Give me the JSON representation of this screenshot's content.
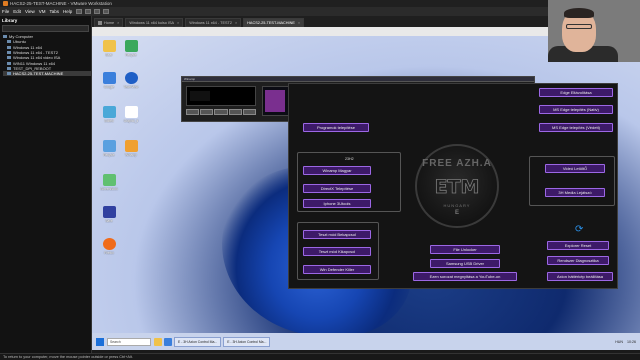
{
  "window": {
    "title": "HACS2-25-TEST-MACHINE - VMware Workstation"
  },
  "menu": [
    "File",
    "Edit",
    "View",
    "VM",
    "Tabs",
    "Help"
  ],
  "tabs": [
    {
      "label": "Home"
    },
    {
      "label": "Windows 11 x64 kulso ISA"
    },
    {
      "label": "Windows 11 x64 - TEST2"
    },
    {
      "label": "HACS2-25-TEST-MACHINE",
      "active": true
    }
  ],
  "library": {
    "header": "Library",
    "items": [
      {
        "label": "My Computer",
        "level": 0
      },
      {
        "label": "Ubuntu",
        "level": 1
      },
      {
        "label": "Windows 11 x64",
        "level": 1
      },
      {
        "label": "Windows 11 x64 - TEST2",
        "level": 1
      },
      {
        "label": "Windows 11 x64 video ISA",
        "level": 1
      },
      {
        "label": "WIN11 Windows 11 x64",
        "level": 1
      },
      {
        "label": "TEST_DPI_REBOOT",
        "level": 1
      },
      {
        "label": "HACS2-25-TEST-MACHINE",
        "level": 1,
        "selected": true
      }
    ]
  },
  "desktop_icons": [
    {
      "label": "Bear",
      "color": "#f0c24a"
    },
    {
      "label": "Recycle",
      "color": "#3aa85c"
    },
    {
      "label": "Google",
      "color": "#3a7fdc"
    },
    {
      "label": "TeamView",
      "color": "#1f5fc6"
    },
    {
      "label": "Edited",
      "color": "#4aa8d8"
    },
    {
      "label": "Graphic_ti",
      "color": "#ffffff"
    },
    {
      "label": "Recycle",
      "color": "#5aa0e0"
    },
    {
      "label": "Winamp",
      "color": "#f0a030"
    },
    {
      "label": "ScreenBook",
      "color": "#60c070"
    },
    {
      "label": "Save",
      "color": "#3040a0"
    },
    {
      "label": "Firefox",
      "color": "#f06b1a"
    }
  ],
  "winamp": {
    "title": "Winamp",
    "playlist_item": "1. Chopper 1 Antidote - Tiesto",
    "playlist_time": "4:02"
  },
  "etm": {
    "logo_top": "FREE AZH.A",
    "logo_main": "ETM",
    "logo_country": "HUNGARY",
    "logo_sub": "E",
    "group_label": "23H2",
    "buttons_left": [
      "Programok telepítése",
      "Winamp Magyar",
      "DirectX Telepítése",
      "Iphone 3Utools"
    ],
    "buttons_bottom_left": [
      "Teszt mód Bekapcsol",
      "Teszt mód Kikapcsol",
      "Win Defender Killer"
    ],
    "buttons_center": [
      "File Unlocker",
      "Samsung USB Driver",
      "Ezen sorozat megnyitása a YouTube-on"
    ],
    "buttons_right_top": [
      "Edge Eltávolítása",
      "MS Edge telepítés (Natív)",
      "MS Edge telepítés (Védett)"
    ],
    "buttons_right_mid": [
      "Videó LetöltŐ",
      "3H Media Lejátszó"
    ],
    "buttons_right_bottom": [
      "Explorer Reset",
      "Rendszer Diagnosztika",
      "Axion háttérkép beállítása"
    ]
  },
  "taskbar": {
    "search_placeholder": "Search",
    "tasks": [
      "E - 3H Axion Control Ma...",
      "E - 3H Axion Control Ma..."
    ],
    "time": "10:26",
    "lang": "HUN"
  },
  "statusbar": "To return to your computer, move the mouse pointer outside or press Ctrl+Alt."
}
